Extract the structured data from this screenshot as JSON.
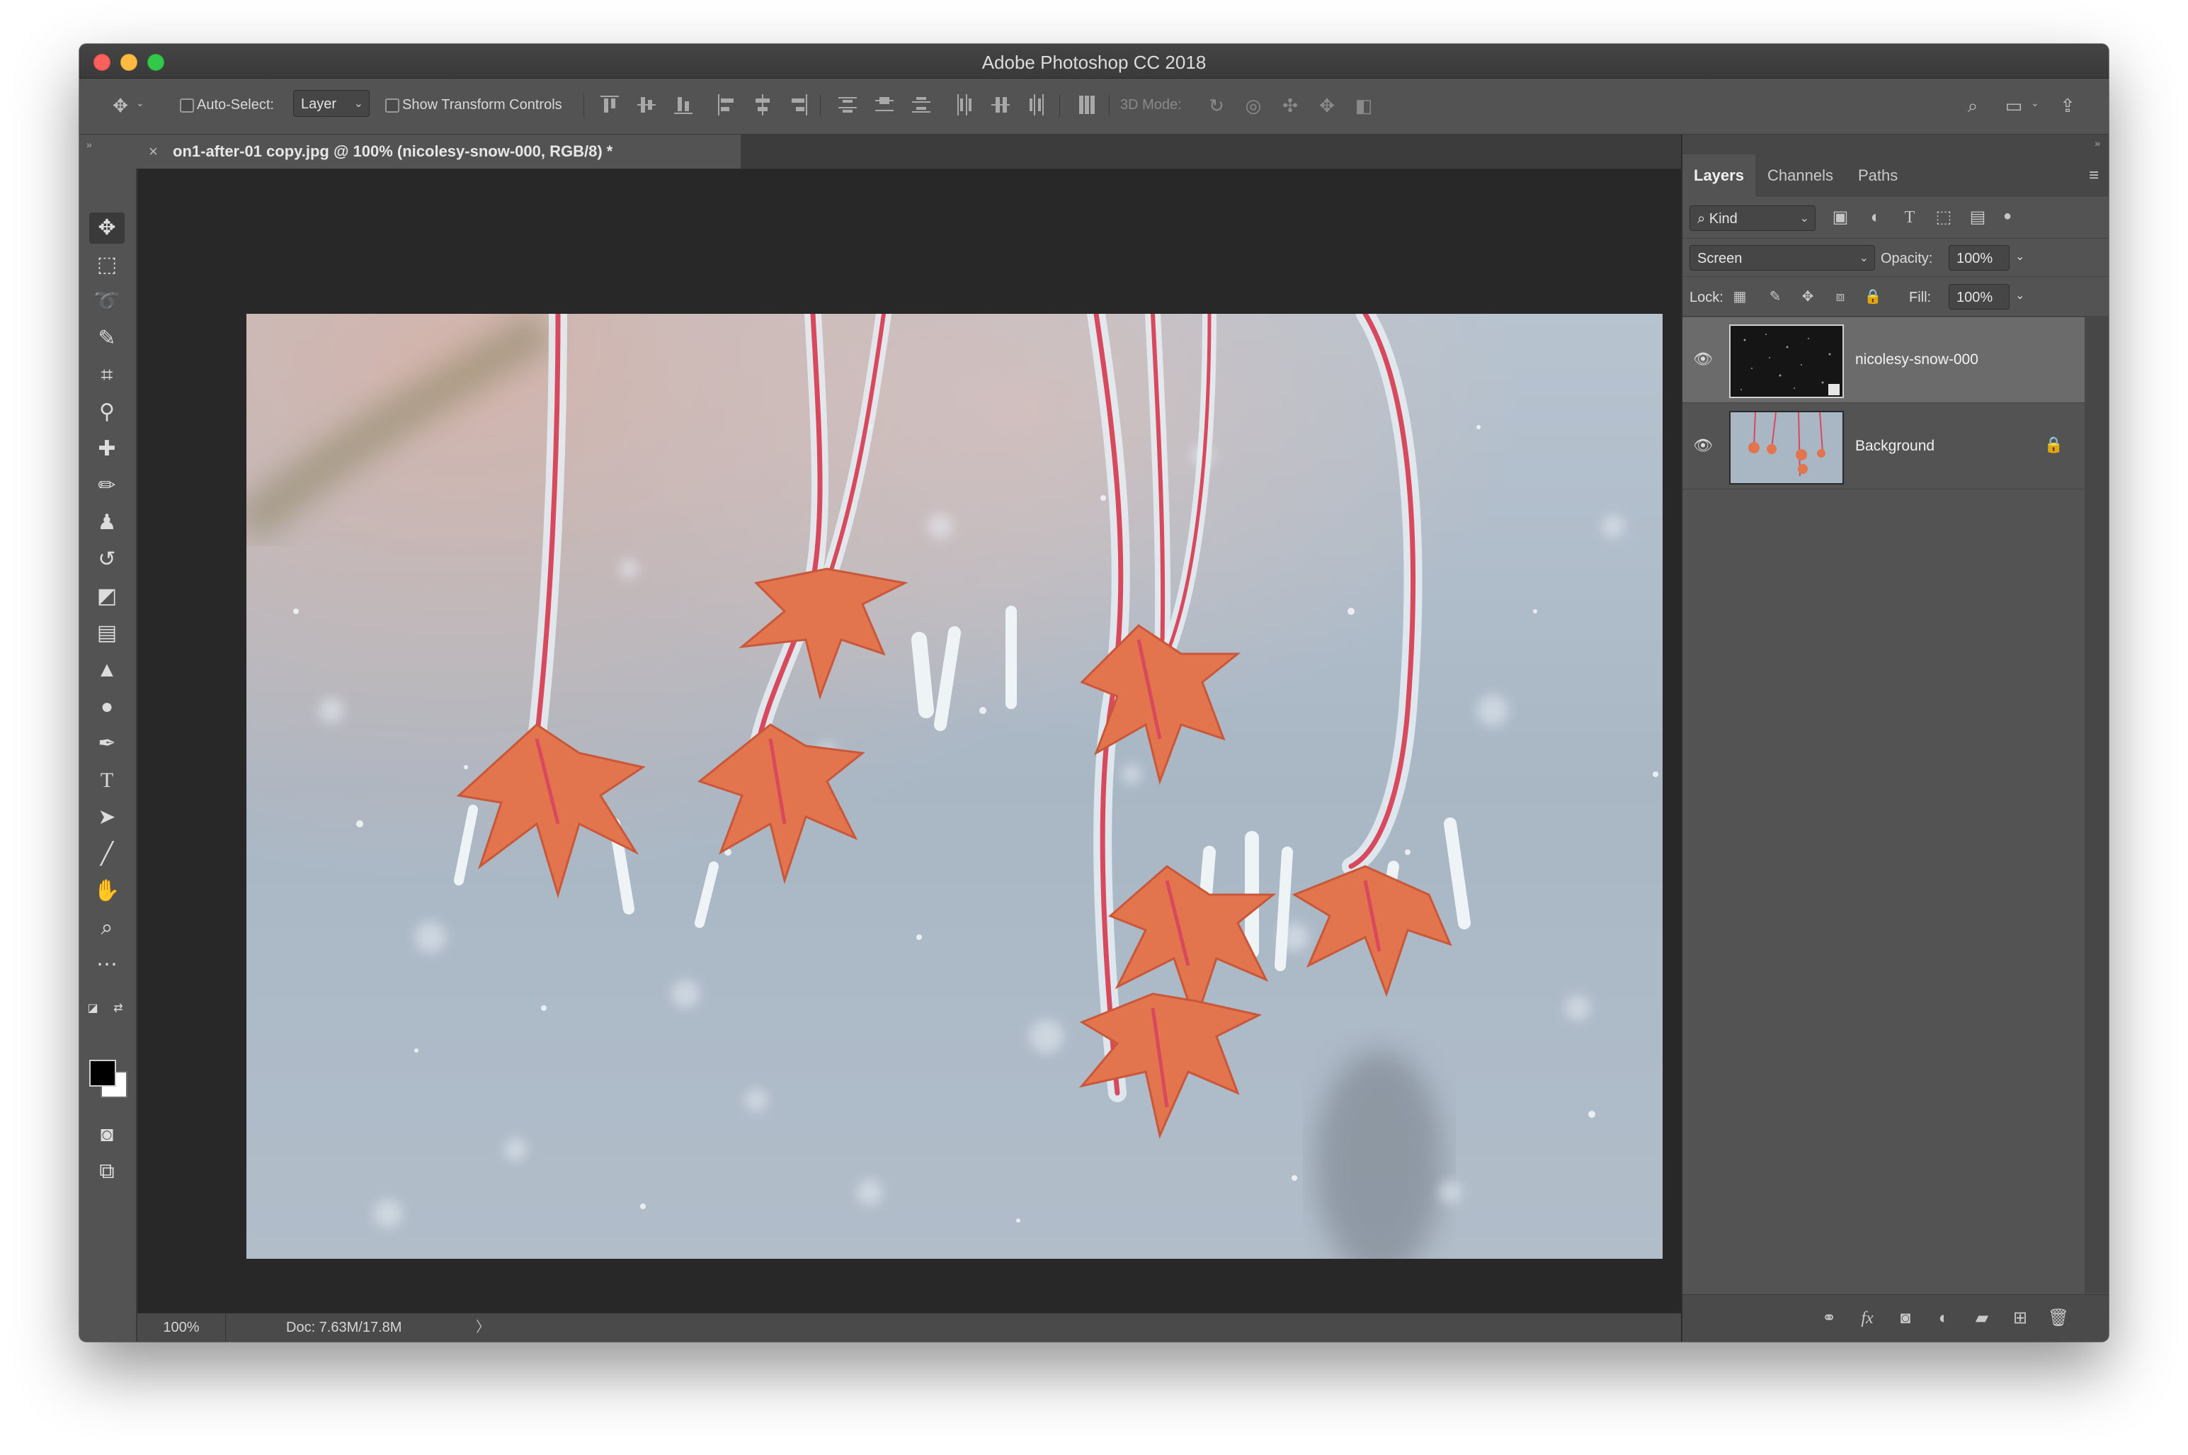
{
  "window": {
    "title": "Adobe Photoshop CC 2018"
  },
  "options_bar": {
    "auto_select_label": "Auto-Select:",
    "auto_select_value": "Layer",
    "show_transform_label": "Show Transform Controls",
    "mode_3d_label": "3D Mode:"
  },
  "document_tab": {
    "close_symbol": "×",
    "title": "on1-after-01 copy.jpg @ 100% (nicolesy-snow-000, RGB/8) *"
  },
  "status_bar": {
    "zoom": "100%",
    "doc_size": "Doc: 7.63M/17.8M",
    "arrow": "〉"
  },
  "layers_panel": {
    "tabs": [
      "Layers",
      "Channels",
      "Paths"
    ],
    "active_tab": "Layers",
    "filter_value": "Kind",
    "blend_mode": "Screen",
    "opacity_label": "Opacity:",
    "opacity_value": "100%",
    "lock_label": "Lock:",
    "fill_label": "Fill:",
    "fill_value": "100%",
    "layers": [
      {
        "name": "nicolesy-snow-000",
        "selected": true,
        "visible": true,
        "locked": false
      },
      {
        "name": "Background",
        "selected": false,
        "visible": true,
        "locked": true
      }
    ],
    "footer_fx": "fx"
  },
  "tools": [
    "move-tool",
    "marquee-tool",
    "lasso-tool",
    "quick-selection-tool",
    "crop-tool",
    "eyedropper-tool",
    "healing-brush-tool",
    "brush-tool",
    "clone-stamp-tool",
    "history-brush-tool",
    "eraser-tool",
    "gradient-tool",
    "blur-tool",
    "dodge-tool",
    "pen-tool",
    "type-tool",
    "path-selection-tool",
    "line-tool",
    "hand-tool",
    "zoom-tool",
    "more-tools"
  ],
  "colors": {
    "foreground": "#000000",
    "background": "#ffffff",
    "ui_dark": "#535353",
    "canvas_bg": "#282828",
    "leaf_orange": "#e2744e"
  }
}
